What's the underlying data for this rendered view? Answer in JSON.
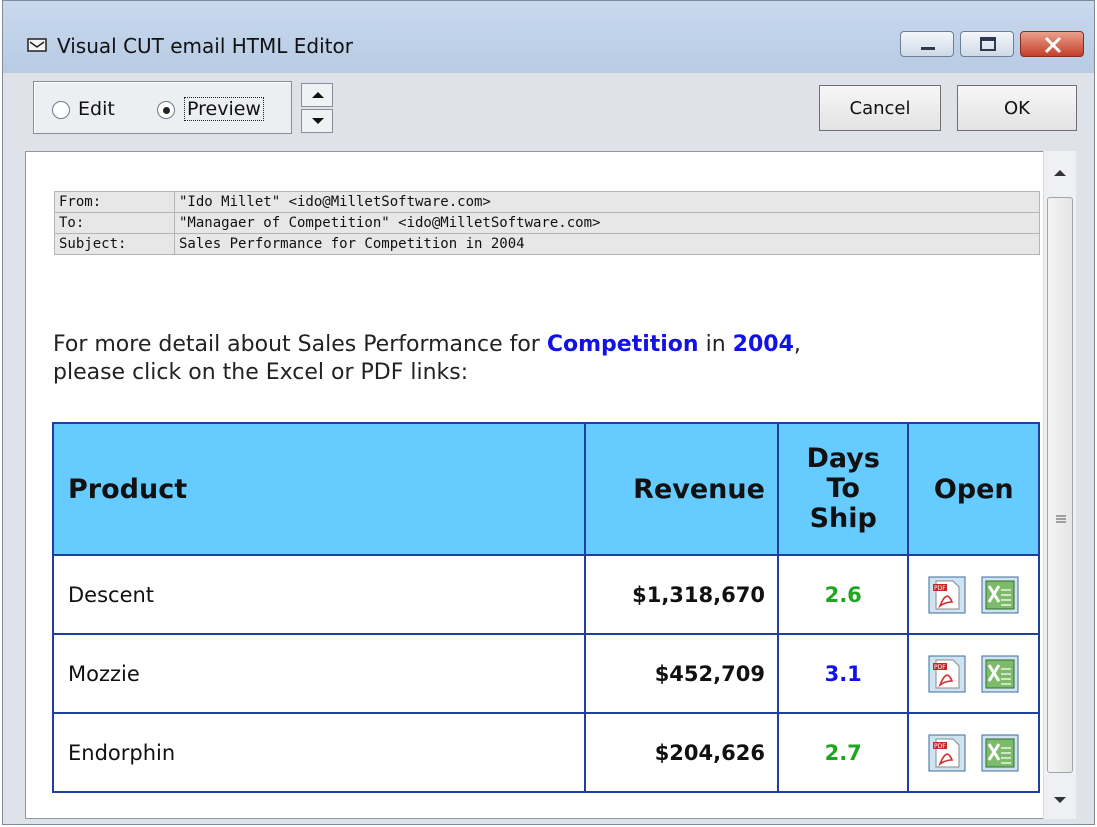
{
  "window": {
    "title": "Visual CUT email HTML Editor"
  },
  "toolbar": {
    "mode_edit_label": "Edit",
    "mode_preview_label": "Preview",
    "selected_mode": "Preview",
    "cancel_label": "Cancel",
    "ok_label": "OK"
  },
  "email": {
    "headers": [
      {
        "label": "From:",
        "value": "\"Ido Millet\" <ido@MilletSoftware.com>"
      },
      {
        "label": "To:",
        "value": "\"Managaer of Competition\" <ido@MilletSoftware.com>"
      },
      {
        "label": "Subject:",
        "value": "Sales Performance for Competition in 2004"
      }
    ],
    "intro": {
      "part1": "For more detail about Sales Performance for ",
      "highlight1": "Competition",
      "part2": " in ",
      "highlight2": "2004",
      "part3": ",",
      "line2": "please click on the Excel or PDF links:"
    }
  },
  "table": {
    "columns": [
      "Product",
      "Revenue",
      "Days To Ship",
      "Open"
    ],
    "rows": [
      {
        "product": "Descent",
        "revenue": "$1,318,670",
        "days": "2.6",
        "days_color": "#1fa51f"
      },
      {
        "product": "Mozzie",
        "revenue": "$452,709",
        "days": "3.1",
        "days_color": "#1212e8"
      },
      {
        "product": "Endorphin",
        "revenue": "$204,626",
        "days": "2.7",
        "days_color": "#1fa51f"
      }
    ]
  },
  "icons": {
    "pdf": "pdf-file-icon",
    "excel": "excel-file-icon"
  },
  "colors": {
    "header_bg": "#66ccff",
    "table_border": "#1e3fa0",
    "highlight_text": "#1212e8"
  }
}
